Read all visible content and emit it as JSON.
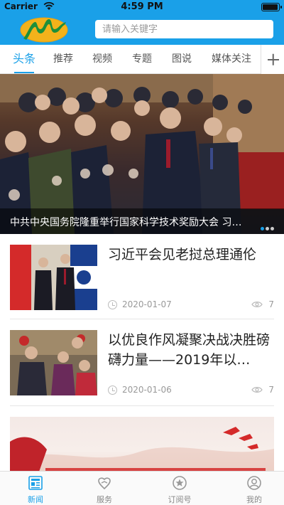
{
  "status_bar": {
    "carrier": "Carrier",
    "time": "4:59 PM",
    "battery_level": 1.0
  },
  "header": {
    "search_placeholder": "请输入关键字",
    "accent_color": "#1aa0e8"
  },
  "tabs": [
    {
      "label": "头条",
      "active": true
    },
    {
      "label": "推荐",
      "active": false
    },
    {
      "label": "视频",
      "active": false
    },
    {
      "label": "专题",
      "active": false
    },
    {
      "label": "图说",
      "active": false
    },
    {
      "label": "媒体关注",
      "active": false
    }
  ],
  "banner": {
    "caption": "中共中央国务院隆重举行国家科学技术奖励大会 习…",
    "slide_count": 3,
    "active_slide": 1
  },
  "news": [
    {
      "title": "习近平会见老挝总理通伦",
      "date": "2020-01-07",
      "views": "7"
    },
    {
      "title": "以优良作风凝聚决战决胜磅礴力量——2019年以…",
      "date": "2020-01-06",
      "views": "7"
    }
  ],
  "tabbar": [
    {
      "label": "新闻",
      "icon": "newspaper-icon",
      "active": true
    },
    {
      "label": "服务",
      "icon": "service-icon",
      "active": false
    },
    {
      "label": "订阅号",
      "icon": "subscribe-icon",
      "active": false
    },
    {
      "label": "我的",
      "icon": "profile-icon",
      "active": false
    }
  ]
}
